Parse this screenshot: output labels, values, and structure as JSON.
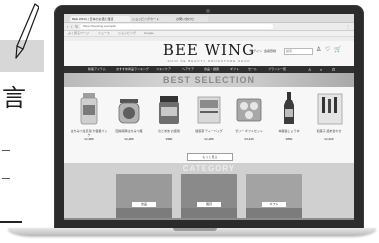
{
  "left_page": {
    "kanji": "言"
  },
  "browser": {
    "tabs": [
      "BEE WING | 日本のお酒と雑貨",
      "ショッピングカート",
      "お問い合わせ"
    ],
    "url": "https://beewing.example/",
    "bookmarks": [
      "よく見るページ",
      "ニュース",
      "ショッピング",
      "Google"
    ]
  },
  "site": {
    "logo": "BEE WING",
    "logo_sub": "SHIN SE BEAUTY DRUGSTORE SHOP",
    "search_placeholder": "検索",
    "util_links": [
      "ログイン",
      "会員登録",
      "カート"
    ],
    "nav_items": [
      "新着アイテム",
      "おすすめ商品ランキング",
      "スキンケア",
      "ヘアケア",
      "食品・健康",
      "ギフト",
      "セール",
      "ブランド一覧"
    ],
    "best_title": "BEST SELECTION",
    "products": [
      {
        "name": "はちみつ生姜湯 大容量パック",
        "price": "¥1,980"
      },
      {
        "name": "国産純粋はちみつ瓶",
        "price": "¥2,480"
      },
      {
        "name": "のどあめ お徳用",
        "price": "¥980"
      },
      {
        "name": "健康茶 ティーバッグ",
        "price": "¥1,280"
      },
      {
        "name": "ゼリー ギフトセット",
        "price": "¥3,240"
      },
      {
        "name": "本醸造しょうゆ",
        "price": "¥860"
      },
      {
        "name": "和菓子 詰め合わせ",
        "price": "¥1,620"
      }
    ],
    "more_label": "もっと見る",
    "category_title": "CATEGORY",
    "categories": [
      "食品",
      "雑貨",
      "ギフト"
    ]
  }
}
